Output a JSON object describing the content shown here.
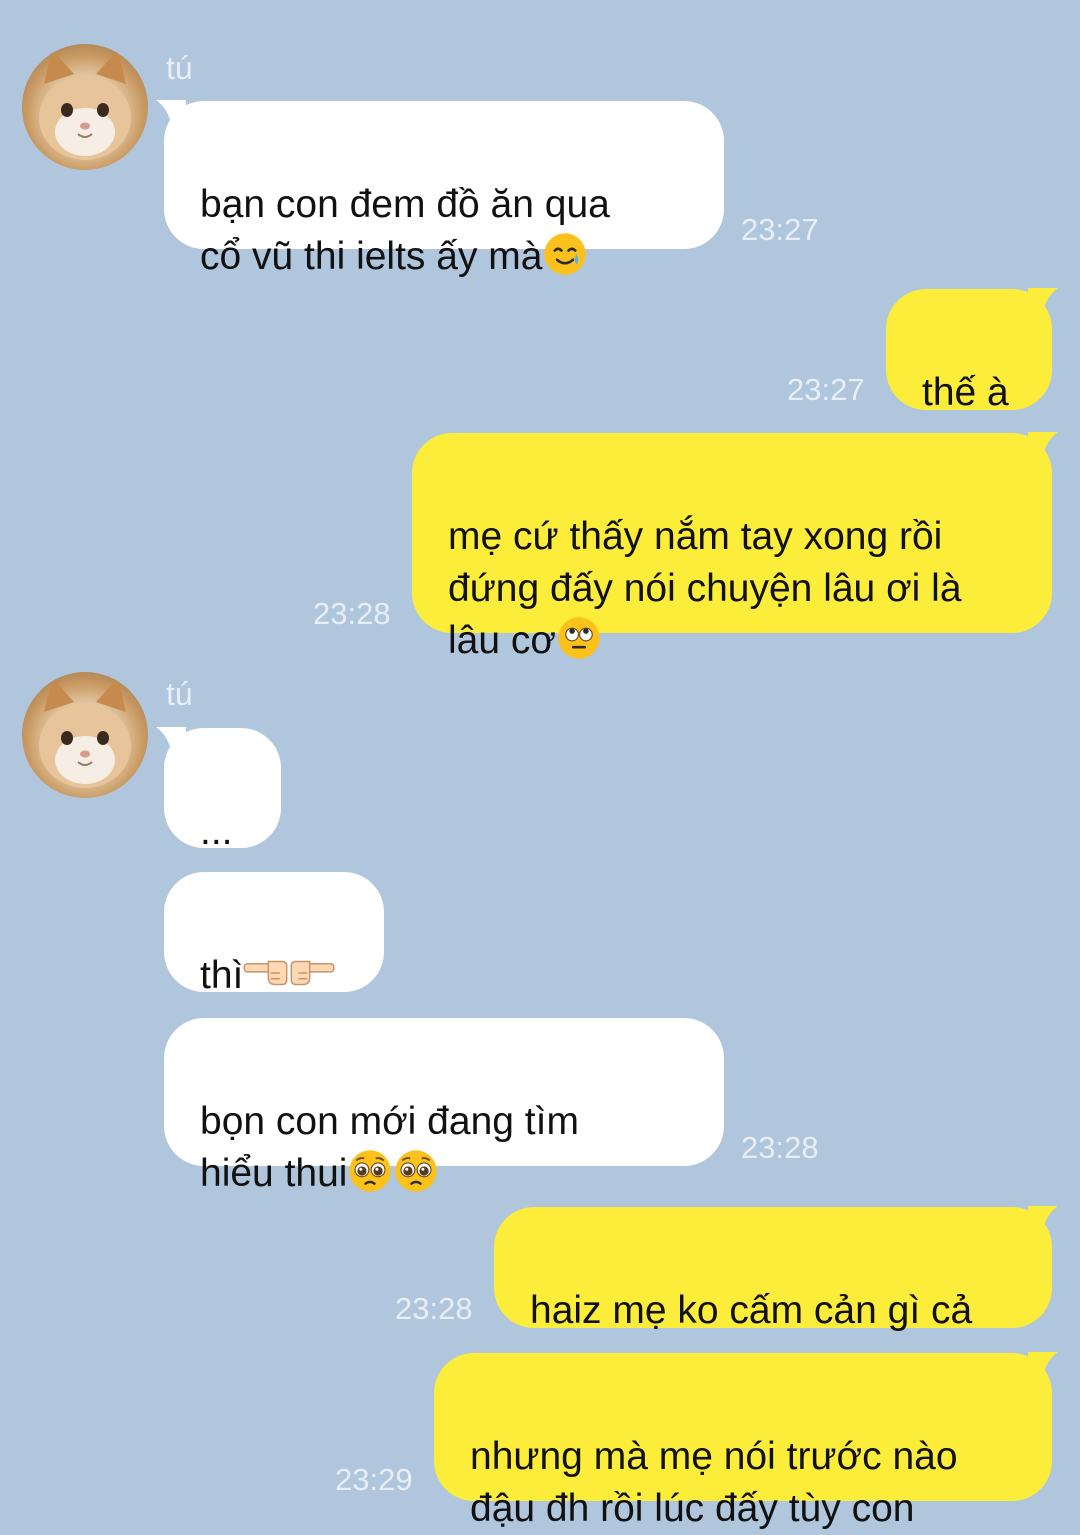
{
  "chat": {
    "contact_name": "tú",
    "messages": [
      {
        "id": "m1",
        "direction": "in",
        "text": "bạn con đem đồ ăn qua\ncổ vũ thi ielts ấy mà",
        "emojis": [
          "smiling-face-with-tear"
        ],
        "time": "23:27"
      },
      {
        "id": "m2",
        "direction": "out",
        "text": "thế à",
        "emojis": [],
        "time": "23:27"
      },
      {
        "id": "m3",
        "direction": "out",
        "text": "mẹ cứ thấy nắm tay xong rồi\nđứng đấy nói chuyện lâu ơi là\nlâu cơ",
        "emojis": [
          "rolling-eyes"
        ],
        "time": "23:28"
      },
      {
        "id": "m4",
        "direction": "in",
        "text": "...",
        "emojis": [],
        "time": ""
      },
      {
        "id": "m5",
        "direction": "in",
        "text": "thì",
        "emojis": [
          "point-right",
          "point-left"
        ],
        "time": ""
      },
      {
        "id": "m6",
        "direction": "in",
        "text": "bọn con mới đang tìm\nhiểu thui",
        "emojis": [
          "pleading-face",
          "pleading-face"
        ],
        "time": "23:28"
      },
      {
        "id": "m7",
        "direction": "out",
        "text": "haiz mẹ ko cấm cản gì cả",
        "emojis": [],
        "time": "23:28"
      },
      {
        "id": "m8",
        "direction": "out",
        "text": "nhưng mà mẹ nói trước nào\nđậu đh rồi lúc đấy tùy con",
        "emojis": [],
        "time": "23:29"
      }
    ]
  },
  "colors": {
    "background": "#b0c6dc",
    "incoming_bubble": "#ffffff",
    "outgoing_bubble": "#fced3a",
    "meta_text": "#e8eef5"
  },
  "icons": {
    "avatar": "cat-photo-avatar"
  }
}
